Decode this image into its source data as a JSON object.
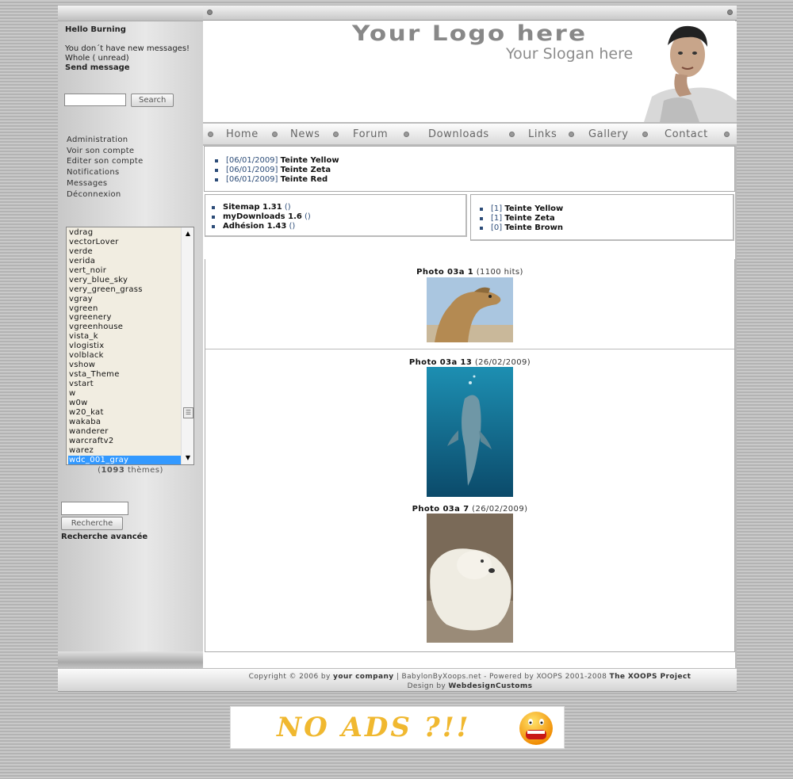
{
  "user": {
    "greeting": "Hello Burning",
    "no_messages": "You don´t have new messages!",
    "whole": "Whole  ( unread)",
    "send": "Send message"
  },
  "search": {
    "button": "Search"
  },
  "admin_menu": [
    "Administration",
    "Voir son compte",
    "Editer son compte",
    "Notifications",
    "Messages",
    "Déconnexion"
  ],
  "themes": {
    "items": [
      "vdrag",
      "vectorLover",
      "verde",
      "verida",
      "vert_noir",
      "very_blue_sky",
      "very_green_grass",
      "vgray",
      "vgreen",
      "vgreenery",
      "vgreenhouse",
      "vista_k",
      "vlogistix",
      "volblack",
      "vshow",
      "vsta_Theme",
      "vstart",
      "w",
      "w0w",
      "w20_kat",
      "wakaba",
      "wanderer",
      "warcraftv2",
      "warez",
      "wdc_001_gray"
    ],
    "selected": "wdc_001_gray",
    "count_open": "(",
    "count": "1093",
    "count_label": " thèmes)"
  },
  "search2": {
    "button": "Recherche",
    "advanced": "Recherche avancée"
  },
  "header": {
    "logo": "Your Logo here",
    "slogan": "Your Slogan here"
  },
  "nav": [
    "Home",
    "News",
    "Forum",
    "Downloads",
    "Links",
    "Gallery",
    "Contact"
  ],
  "news": [
    {
      "date": "[06/01/2009]",
      "title": "Teinte Yellow"
    },
    {
      "date": "[06/01/2009]",
      "title": "Teinte Zeta"
    },
    {
      "date": "[06/01/2009]",
      "title": "Teinte Red"
    }
  ],
  "modules": [
    {
      "name": "Sitemap 1.31",
      "extra": " ()"
    },
    {
      "name": "myDownloads 1.6",
      "extra": " ()"
    },
    {
      "name": "Adhésion 1.43",
      "extra": " ()"
    }
  ],
  "downloads": [
    {
      "count": "[1]",
      "title": "Teinte Yellow"
    },
    {
      "count": "[1]",
      "title": "Teinte Zeta"
    },
    {
      "count": "[0]",
      "title": "Teinte Brown"
    }
  ],
  "photos": [
    {
      "title": "Photo 03a 1",
      "meta": " (1100 hits)"
    },
    {
      "title": "Photo 03a 13",
      "meta": " (26/02/2009)"
    },
    {
      "title": "Photo 03a 7",
      "meta": " (26/02/2009)"
    }
  ],
  "footer": {
    "copyright": "Copyright © 2006 by ",
    "company": "your company",
    "sep": "  |  BabylonByXoops.net - Powered by XOOPS 2001-2008 ",
    "project": "The XOOPS Project",
    "design": "Design by ",
    "designer": "WebdesignCustoms"
  },
  "banner": {
    "text": "NO ADS ?!!"
  },
  "colors": {
    "link": "#2c4c78",
    "selected": "#3399ff",
    "listbg": "#f1ede1",
    "banner": "#f0b830"
  }
}
